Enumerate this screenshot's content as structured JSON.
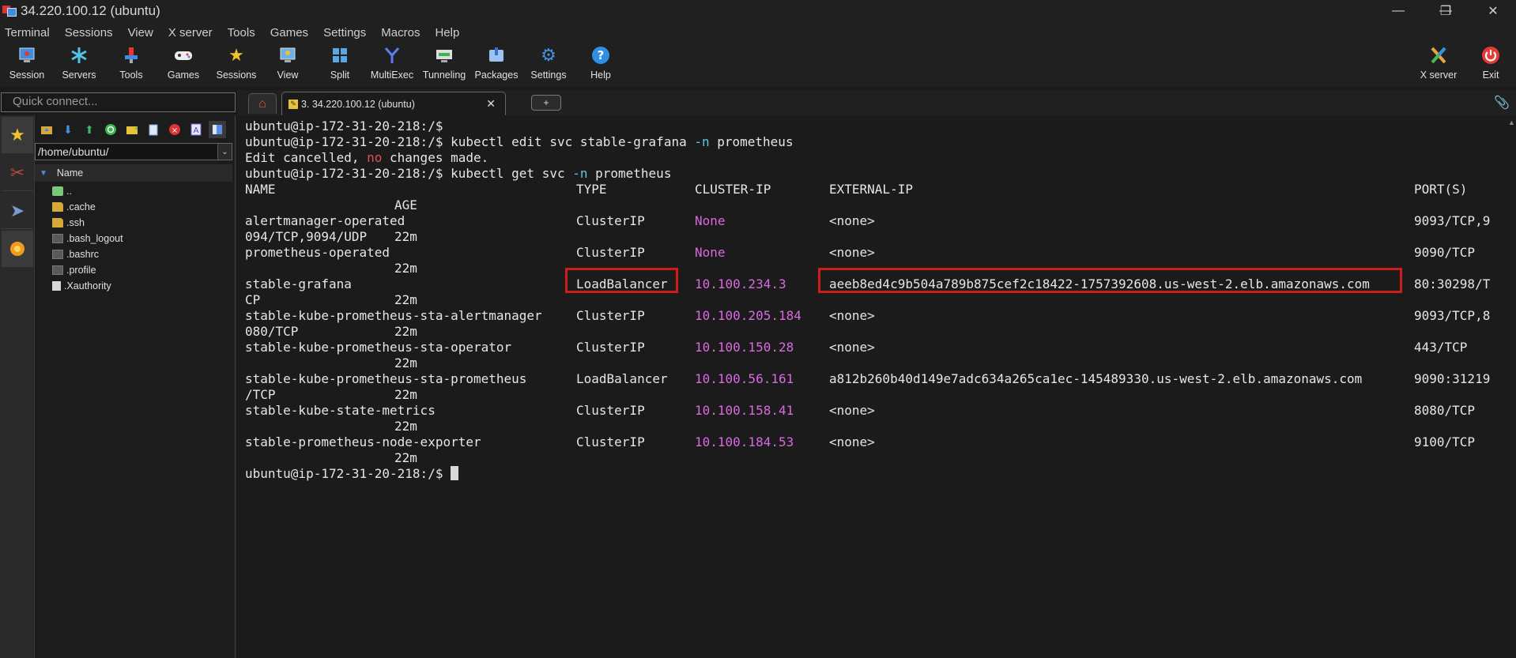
{
  "window": {
    "title": "34.220.100.12 (ubuntu)",
    "minimize": "—",
    "restore": "❐",
    "close": "✕"
  },
  "menu": [
    "Terminal",
    "Sessions",
    "View",
    "X server",
    "Tools",
    "Games",
    "Settings",
    "Macros",
    "Help"
  ],
  "toolbar": {
    "session": "Session",
    "servers": "Servers",
    "tools": "Tools",
    "games": "Games",
    "sessions": "Sessions",
    "view": "View",
    "split": "Split",
    "multiexec": "MultiExec",
    "tunneling": "Tunneling",
    "packages": "Packages",
    "settings": "Settings",
    "help": "Help",
    "xserver": "X server",
    "exit": "Exit"
  },
  "quick_connect": {
    "placeholder": "Quick connect..."
  },
  "tabs": {
    "session_tab": "3. 34.220.100.12 (ubuntu)",
    "new_tab": "+"
  },
  "sftp": {
    "path": "/home/ubuntu/",
    "column": "Name",
    "files": [
      "..",
      ".cache",
      ".ssh",
      ".bash_logout",
      ".bashrc",
      ".profile",
      ".Xauthority"
    ]
  },
  "terminal": {
    "prompt": "ubuntu@ip-172-31-20-218:/$",
    "cmd1_a": "kubectl edit svc stable-grafana ",
    "cmd1_flag": "-n",
    "cmd1_b": " prometheus",
    "edit_a": "Edit cancelled, ",
    "edit_no": "no",
    "edit_b": " changes made.",
    "cmd2_a": "kubectl get svc ",
    "cmd2_flag": "-n",
    "cmd2_b": " prometheus",
    "headers": {
      "name": "NAME",
      "type": "TYPE",
      "cluster_ip": "CLUSTER-IP",
      "external_ip": "EXTERNAL-IP",
      "ports": "PORT(S)",
      "age": "AGE"
    },
    "rows": [
      {
        "name": "alertmanager-operated",
        "type": "ClusterIP",
        "cluster_ip": "None",
        "external_ip": "<none>",
        "ports": "9093/TCP,9",
        "wrap": "094/TCP,9094/UDP",
        "age": "22m"
      },
      {
        "name": "prometheus-operated",
        "type": "ClusterIP",
        "cluster_ip": "None",
        "external_ip": "<none>",
        "ports": "9090/TCP",
        "wrap": "",
        "age": "22m"
      },
      {
        "name": "stable-grafana",
        "type": "LoadBalancer",
        "cluster_ip": "10.100.234.3",
        "external_ip": "aeeb8ed4c9b504a789b875cef2c18422-1757392608.us-west-2.elb.amazonaws.com",
        "ports": "80:30298/T",
        "wrap": "CP",
        "age": "22m"
      },
      {
        "name": "stable-kube-prometheus-sta-alertmanager",
        "type": "ClusterIP",
        "cluster_ip": "10.100.205.184",
        "external_ip": "<none>",
        "ports": "9093/TCP,8",
        "wrap": "080/TCP",
        "age": "22m"
      },
      {
        "name": "stable-kube-prometheus-sta-operator",
        "type": "ClusterIP",
        "cluster_ip": "10.100.150.28",
        "external_ip": "<none>",
        "ports": "443/TCP",
        "wrap": "",
        "age": "22m"
      },
      {
        "name": "stable-kube-prometheus-sta-prometheus",
        "type": "LoadBalancer",
        "cluster_ip": "10.100.56.161",
        "external_ip": "a812b260b40d149e7adc634a265ca1ec-145489330.us-west-2.elb.amazonaws.com",
        "ports": "9090:31219",
        "wrap": "/TCP",
        "age": "22m"
      },
      {
        "name": "stable-kube-state-metrics",
        "type": "ClusterIP",
        "cluster_ip": "10.100.158.41",
        "external_ip": "<none>",
        "ports": "8080/TCP",
        "wrap": "",
        "age": "22m"
      },
      {
        "name": "stable-prometheus-node-exporter",
        "type": "ClusterIP",
        "cluster_ip": "10.100.184.53",
        "external_ip": "<none>",
        "ports": "9100/TCP",
        "wrap": "",
        "age": "22m"
      }
    ]
  },
  "colors": {
    "flag": "#5cc8e6",
    "no_word": "#e05050",
    "ip": "#d86adf",
    "highlight_box": "#d11c1c"
  }
}
